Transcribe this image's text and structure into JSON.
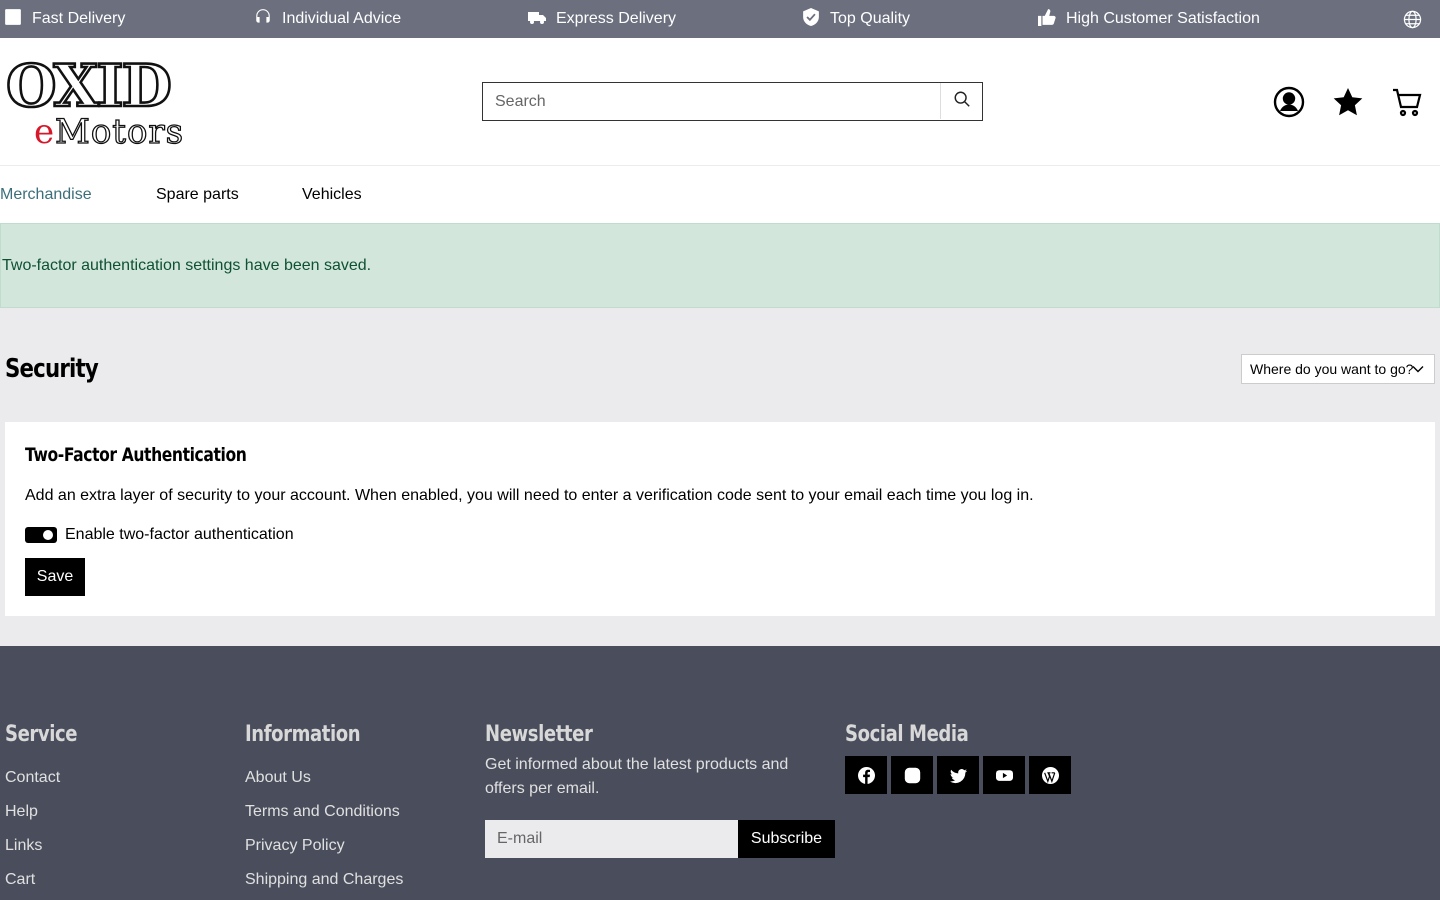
{
  "topbar": {
    "usps": [
      {
        "label": "Fast Delivery",
        "icon": "box-icon"
      },
      {
        "label": "Individual Advice",
        "icon": "headset-icon"
      },
      {
        "label": "Express Delivery",
        "icon": "truck-icon"
      },
      {
        "label": "Top Quality",
        "icon": "shield-check-icon"
      },
      {
        "label": "High Customer Satisfaction",
        "icon": "thumbs-up-icon"
      }
    ],
    "language_icon": "globe-icon"
  },
  "header": {
    "logo_text_top": "OXID",
    "logo_text_bottom_e": "e",
    "logo_text_bottom_rest": "Motors",
    "search_placeholder": "Search",
    "icons": [
      "account-icon",
      "wishlist-star-icon",
      "cart-icon"
    ]
  },
  "nav": {
    "items": [
      "Merchandise",
      "Spare parts",
      "Vehicles"
    ],
    "active": "Merchandise"
  },
  "alert": {
    "message": "Two-factor authentication settings have been saved."
  },
  "main": {
    "title": "Security",
    "account_nav_select": "Where do you want to go?",
    "card": {
      "heading": "Two-Factor Authentication",
      "description": "Add an extra layer of security to your account. When enabled, you will need to enter a verification code sent to your email each time you log in.",
      "toggle_label": "Enable two-factor authentication",
      "toggle_on": true,
      "save_label": "Save"
    }
  },
  "footer": {
    "service": {
      "heading": "Service",
      "links": [
        "Contact",
        "Help",
        "Links",
        "Cart"
      ]
    },
    "information": {
      "heading": "Information",
      "links": [
        "About Us",
        "Terms and Conditions",
        "Privacy Policy",
        "Shipping and Charges"
      ]
    },
    "newsletter": {
      "heading": "Newsletter",
      "text": "Get informed about the latest products and offers per email.",
      "email_placeholder": "E-mail",
      "subscribe_label": "Subscribe"
    },
    "social": {
      "heading": "Social Media",
      "icons": [
        "facebook-icon",
        "instagram-icon",
        "twitter-icon",
        "youtube-icon",
        "wordpress-icon"
      ]
    }
  },
  "colors": {
    "topbar_bg": "#6b6f7e",
    "alert_bg": "#d2e6dc",
    "alert_text": "#0f5132",
    "main_bg": "#ebebed",
    "footer_bg": "#4a4e5c",
    "nav_active": "#3b6f7a"
  }
}
